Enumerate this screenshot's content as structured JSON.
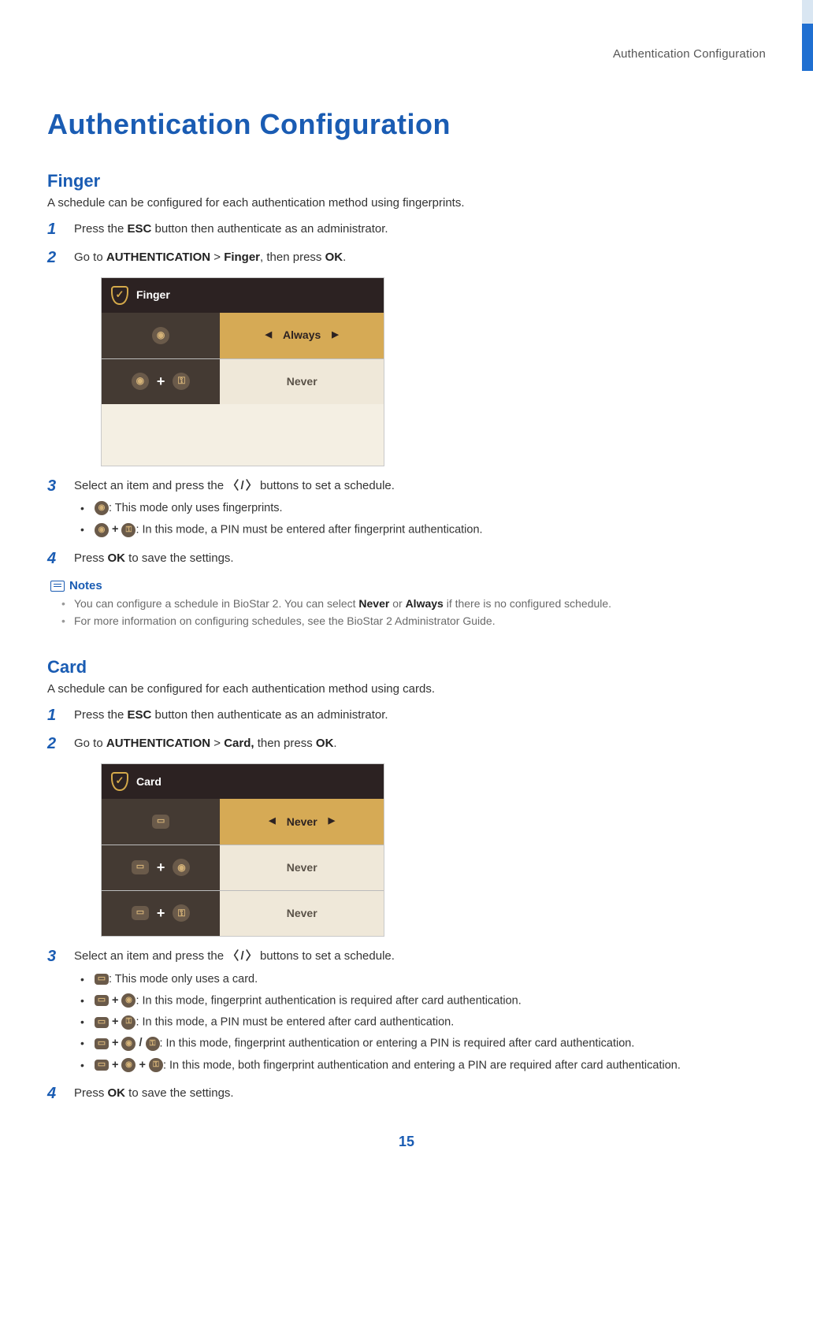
{
  "running_head": "Authentication  Configuration",
  "h1": "Authentication Configuration",
  "page_number": "15",
  "finger": {
    "h2": "Finger",
    "intro": "A schedule can be configured for each authentication method using fingerprints.",
    "steps": {
      "s1_pre": "Press the ",
      "s1_b": "ESC",
      "s1_post": " button then authenticate as an administrator.",
      "s2_pre": "Go to ",
      "s2_b1": "AUTHENTICATION",
      "s2_mid": " > ",
      "s2_b2": "Finger",
      "s2_post1": ", then press ",
      "s2_b3": "OK",
      "s2_post2": ".",
      "s3_pre": "Select an item and press the ",
      "s3_arrows": "〈 / 〉",
      "s3_post": " buttons to set a schedule.",
      "s3_bullets": {
        "b1": ": This mode only uses fingerprints.",
        "b2": ": In this mode, a PIN must be entered after fingerprint authentication."
      },
      "s4_pre": "Press ",
      "s4_b": "OK",
      "s4_post": " to save the settings."
    },
    "device": {
      "title": "Finger",
      "row1_value": "Always",
      "row2_value": "Never"
    }
  },
  "notes": {
    "label": "Notes",
    "n1_pre": "You can configure a schedule in BioStar 2. You can select ",
    "n1_b1": "Never",
    "n1_mid": " or ",
    "n1_b2": "Always",
    "n1_post": " if there is no configured schedule.",
    "n2": "For more information on configuring schedules, see the BioStar 2 Administrator Guide."
  },
  "card": {
    "h2": "Card",
    "intro": "A schedule can be configured for each authentication method using cards.",
    "steps": {
      "s1_pre": "Press the ",
      "s1_b": "ESC",
      "s1_post": " button then authenticate as an administrator.",
      "s2_pre": "Go to ",
      "s2_b1": "AUTHENTICATION",
      "s2_mid": " > ",
      "s2_b2": "Card,",
      "s2_post1": " then press ",
      "s2_b3": "OK",
      "s2_post2": ".",
      "s3_pre": "Select an item and press the ",
      "s3_arrows": "〈 / 〉",
      "s3_post": " buttons to set a schedule.",
      "s3_bullets": {
        "b1": ": This mode only uses a card.",
        "b2": ": In this mode, fingerprint authentication is required after card authentication.",
        "b3": ": In this mode, a PIN must be entered after card authentication.",
        "b4": ": In  this  mode,  fingerprint  authentication  or  entering  a  PIN  is  required  after  card authentication.",
        "b5": ": In this mode, both fingerprint authentication and entering a PIN are required after card authentication."
      },
      "s4_pre": "Press ",
      "s4_b": "OK",
      "s4_post": " to save the settings."
    },
    "device": {
      "title": "Card",
      "row1_value": "Never",
      "row2_value": "Never",
      "row3_value": "Never"
    }
  },
  "glyphs": {
    "plus": "+",
    "slash": " / "
  }
}
